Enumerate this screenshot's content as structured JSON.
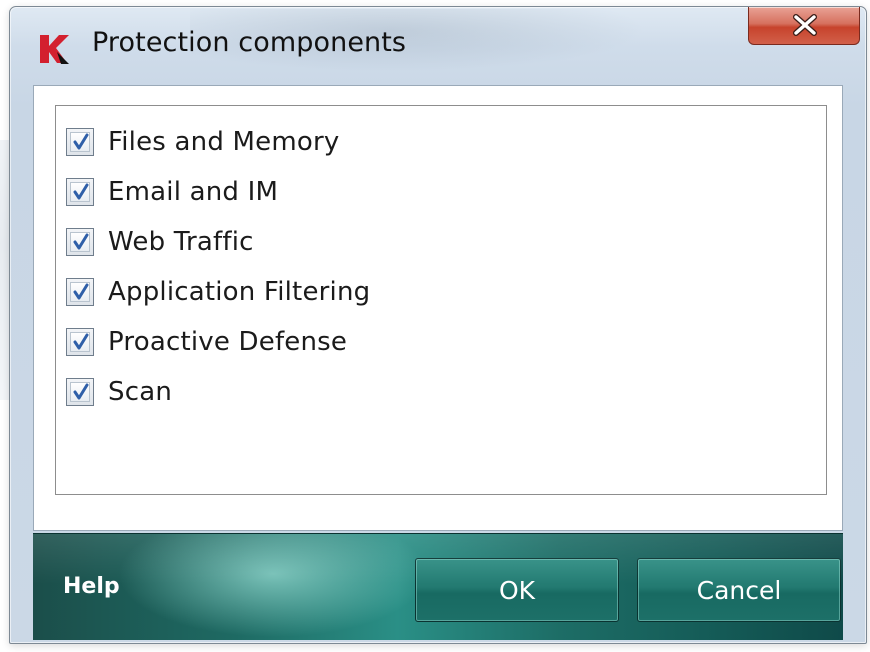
{
  "window": {
    "title": "Protection components",
    "app_icon": "kaspersky-k-logo",
    "close_icon": "close-x-icon"
  },
  "components": [
    {
      "label": "Files and Memory",
      "checked": true
    },
    {
      "label": "Email and IM",
      "checked": true
    },
    {
      "label": "Web Traffic",
      "checked": true
    },
    {
      "label": "Application Filtering",
      "checked": true
    },
    {
      "label": "Proactive Defense",
      "checked": true
    },
    {
      "label": "Scan",
      "checked": true
    }
  ],
  "footer": {
    "help_label": "Help",
    "ok_label": "OK",
    "cancel_label": "Cancel"
  },
  "colors": {
    "brand_red": "#d3202f",
    "footer_teal": "#1e6a63",
    "close_red": "#c7432c",
    "check_blue": "#2f5fa8"
  }
}
